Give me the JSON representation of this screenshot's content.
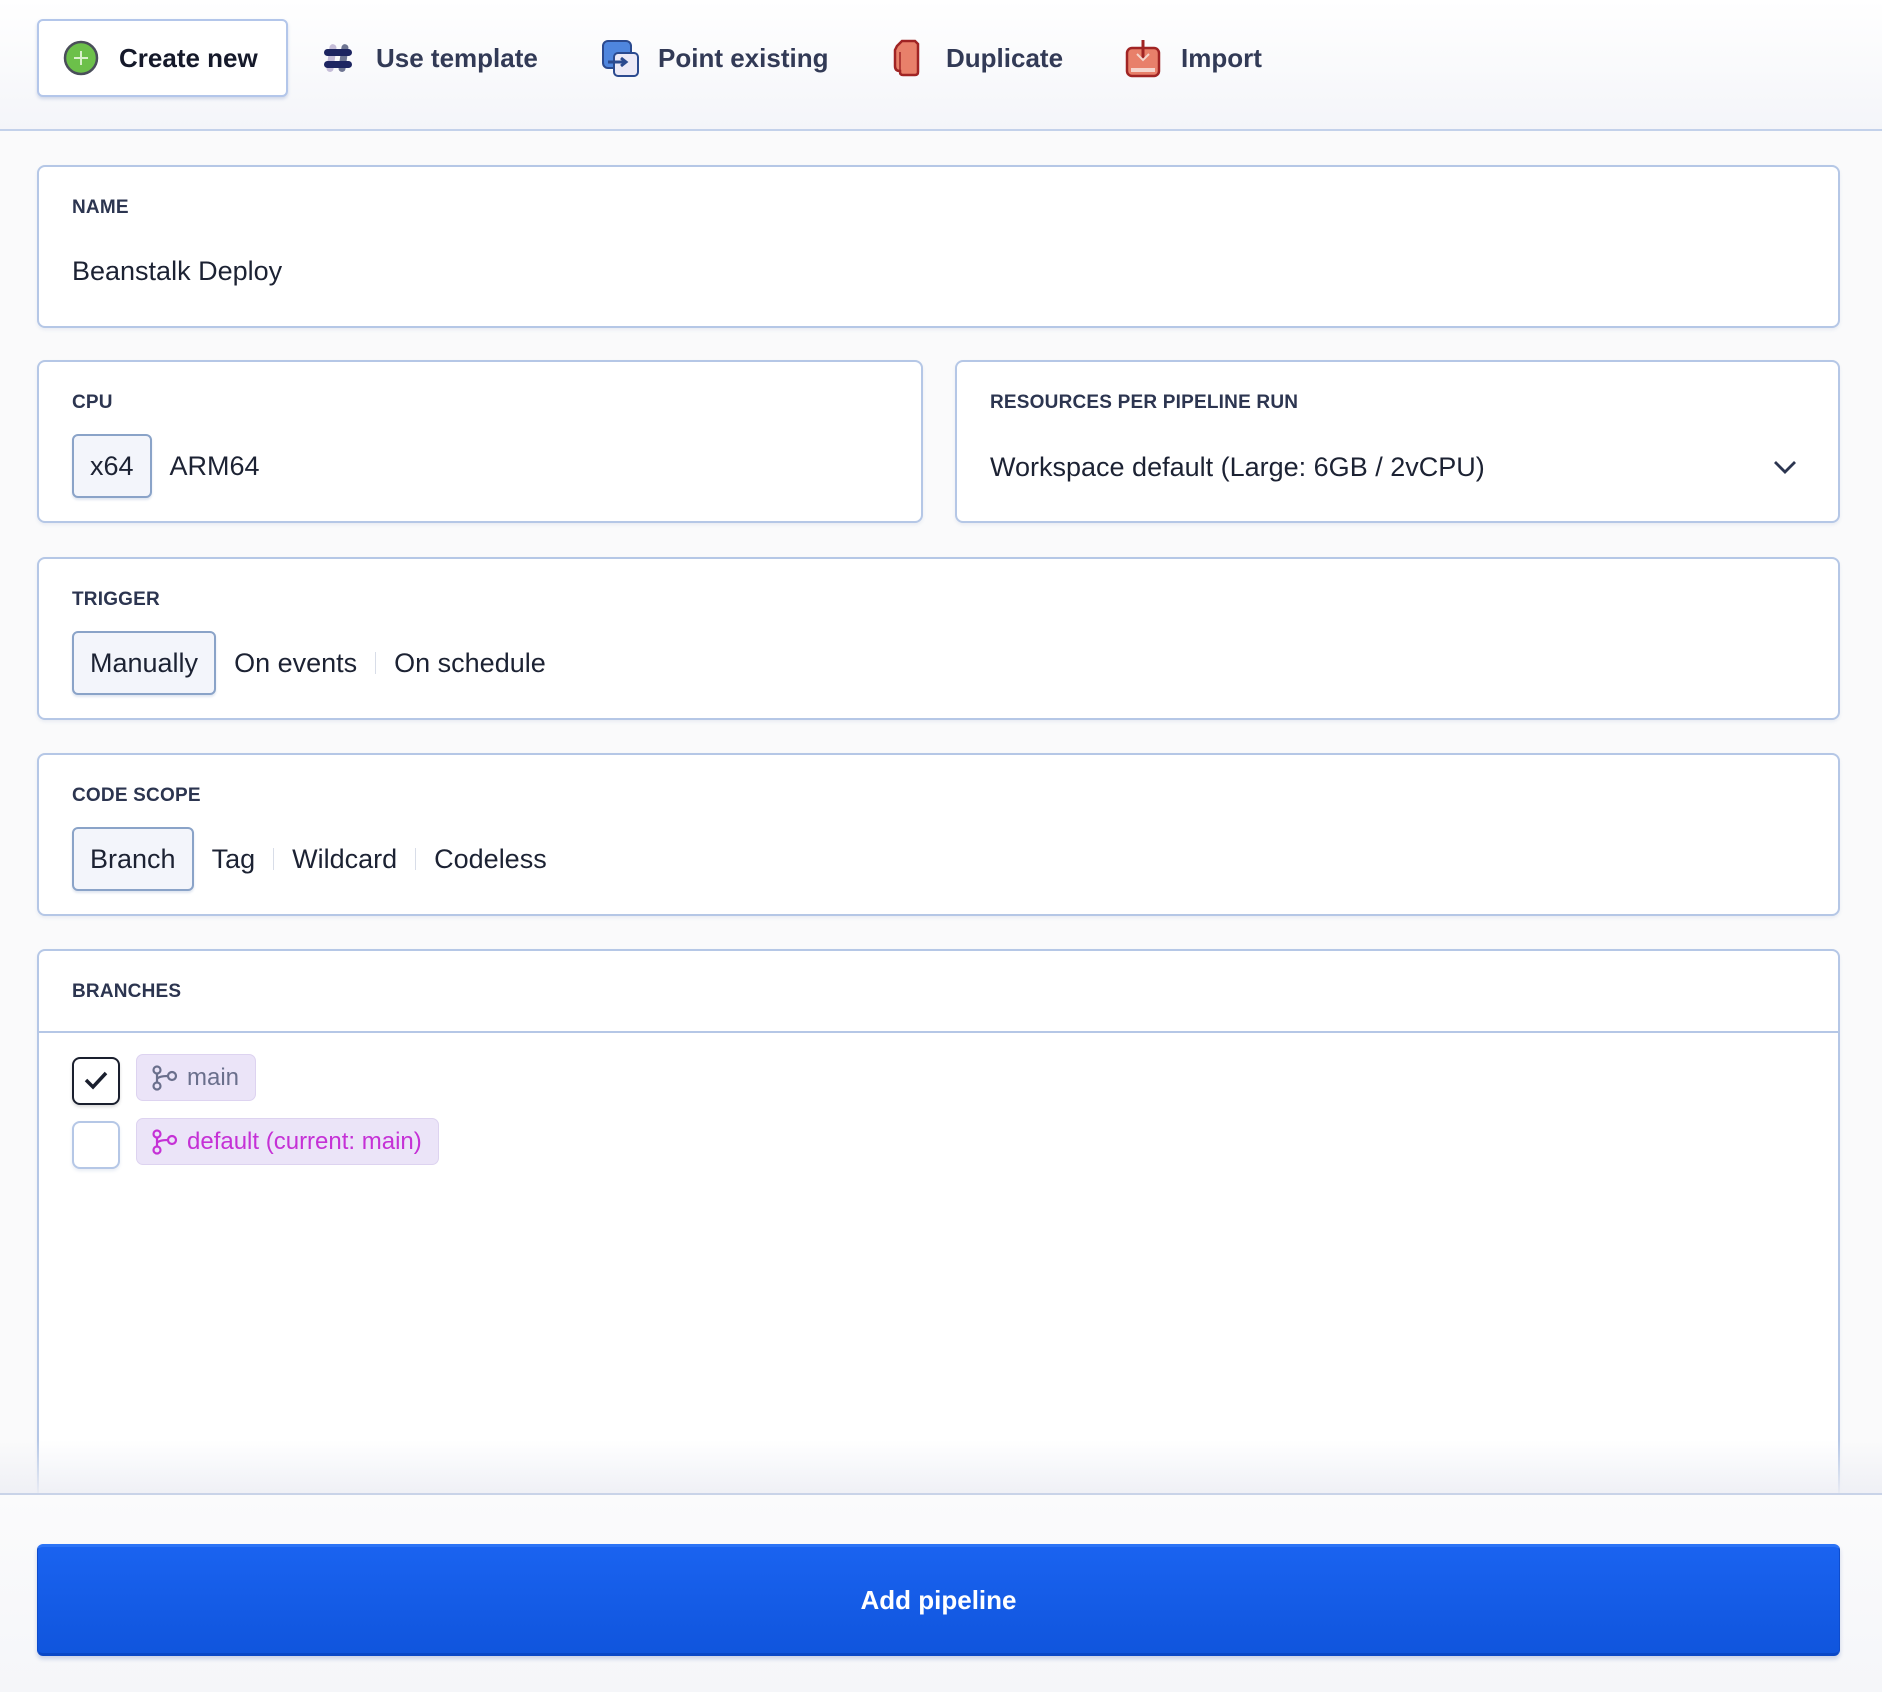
{
  "tabs": [
    {
      "label": "Create new",
      "icon": "plus-circle-icon",
      "active": true
    },
    {
      "label": "Use template",
      "icon": "hash-icon",
      "active": false
    },
    {
      "label": "Point existing",
      "icon": "point-arrow-icon",
      "active": false
    },
    {
      "label": "Duplicate",
      "icon": "duplicate-icon",
      "active": false
    },
    {
      "label": "Import",
      "icon": "import-icon",
      "active": false
    }
  ],
  "name": {
    "label": "NAME",
    "value": "Beanstalk Deploy"
  },
  "cpu": {
    "label": "CPU",
    "options": [
      "x64",
      "ARM64"
    ],
    "selected": "x64"
  },
  "resources": {
    "label": "RESOURCES PER PIPELINE RUN",
    "value": "Workspace default (Large: 6GB / 2vCPU)"
  },
  "trigger": {
    "label": "TRIGGER",
    "options": [
      "Manually",
      "On events",
      "On schedule"
    ],
    "selected": "Manually"
  },
  "code_scope": {
    "label": "CODE SCOPE",
    "options": [
      "Branch",
      "Tag",
      "Wildcard",
      "Codeless"
    ],
    "selected": "Branch"
  },
  "branches": {
    "label": "BRANCHES",
    "items": [
      {
        "name": "main",
        "checked": true,
        "color": "#6a6f8c"
      },
      {
        "name": "default (current: main)",
        "checked": false,
        "color": "#c531d6"
      }
    ]
  },
  "colors": {
    "primary": "#1a63f0",
    "create_icon": "#6cc04a",
    "card_border": "#b5c7e6"
  },
  "footer": {
    "submit_label": "Add pipeline"
  }
}
